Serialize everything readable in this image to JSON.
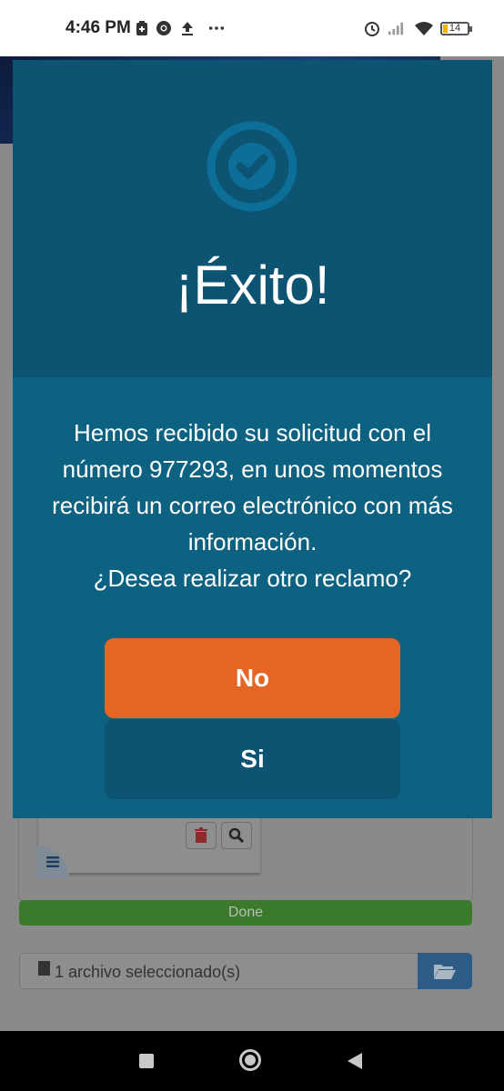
{
  "status_bar": {
    "time": "4:46 PM",
    "battery_level": "14",
    "icons": [
      "sim-icon",
      "chrome-icon",
      "upload-icon",
      "more-icon",
      "alarm-icon",
      "signal-icon",
      "wifi-icon",
      "battery-icon"
    ]
  },
  "background_page": {
    "done_label": "Done",
    "file_label": "1 archivo seleccionado(s)",
    "icons": [
      "trash-icon",
      "zoom-icon",
      "menu-icon",
      "file-icon",
      "folder-open-icon"
    ]
  },
  "modal": {
    "icon": "check-circle-icon",
    "title": "¡Éxito!",
    "message": "Hemos recibido su solicitud con el número 977293, en unos momentos recibirá un correo electrónico con más información.\n¿Desea realizar otro reclamo?",
    "buttons": {
      "no_label": "No",
      "si_label": "Si"
    }
  },
  "nav_bar": {
    "icons": [
      "recents-icon",
      "home-icon",
      "back-icon"
    ]
  },
  "colors": {
    "header": "#0c5472",
    "body": "#0e6281",
    "no_button": "#e56525",
    "si_button": "#0c5472"
  }
}
